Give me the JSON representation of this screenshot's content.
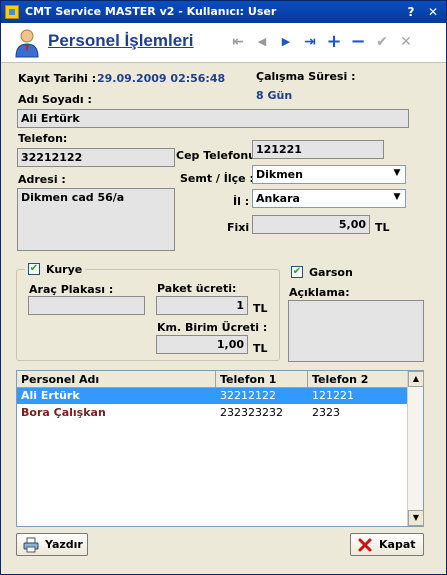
{
  "window": {
    "title": "CMT Service MASTER v2  -  Kullanıcı: User",
    "help_btn": "?",
    "close_btn": "✕"
  },
  "header": {
    "title": "Personel İşlemleri",
    "nav": {
      "first": "⇤",
      "prev": "◀",
      "next": "▶",
      "last": "⇥",
      "add": "+",
      "delete": "−",
      "confirm": "✔",
      "cancel": "✕"
    }
  },
  "form": {
    "kayit_tarihi_label": "Kayıt Tarihi :",
    "kayit_tarihi_value": "29.09.2009 02:56:48",
    "calisma_suresi_label": "Çalışma Süresi :",
    "calisma_suresi_value": "8 Gün",
    "adi_soyadi_label": "Adı Soyadı :",
    "adi_soyadi_value": "Ali Ertürk",
    "telefon_label": "Telefon:",
    "telefon_value": "32212122",
    "cep_telefonu_label": "Cep Telefonu:",
    "cep_telefonu_value": "121221",
    "adresi_label": "Adresi :",
    "adresi_value": "Dikmen cad 56/a",
    "semt_ilce_label": "Semt / İlçe :",
    "semt_ilce_value": "Dikmen",
    "il_label": "İl :",
    "il_value": "Ankara",
    "fixi_label": "Fixi :",
    "fixi_value": "5,00",
    "fixi_unit": "TL"
  },
  "kurye": {
    "label": "Kurye",
    "checked": true,
    "arac_plakasi_label": "Araç Plakası :",
    "arac_plakasi_value": "",
    "paket_ucreti_label": "Paket ücreti:",
    "paket_ucreti_value": "1",
    "paket_ucreti_unit": "TL",
    "km_birim_label": "Km. Birim Ücreti :",
    "km_birim_value": "1,00",
    "km_birim_unit": "TL"
  },
  "garson": {
    "label": "Garson",
    "checked": true,
    "aciklama_label": "Açıklama:",
    "aciklama_value": ""
  },
  "grid": {
    "columns": [
      "Personel Adı",
      "Telefon 1",
      "Telefon 2"
    ],
    "rows": [
      {
        "name": "Ali Ertürk",
        "tel1": "32212122",
        "tel2": "121221",
        "selected": true
      },
      {
        "name": "Bora Çalışkan",
        "tel1": "232323232",
        "tel2": "2323",
        "selected": false
      }
    ]
  },
  "buttons": {
    "print": "Yazdır",
    "close": "Kapat"
  },
  "colors": {
    "title_blue": "#1f3f8f",
    "selection": "#3399ff",
    "row_name": "#7a2020"
  }
}
